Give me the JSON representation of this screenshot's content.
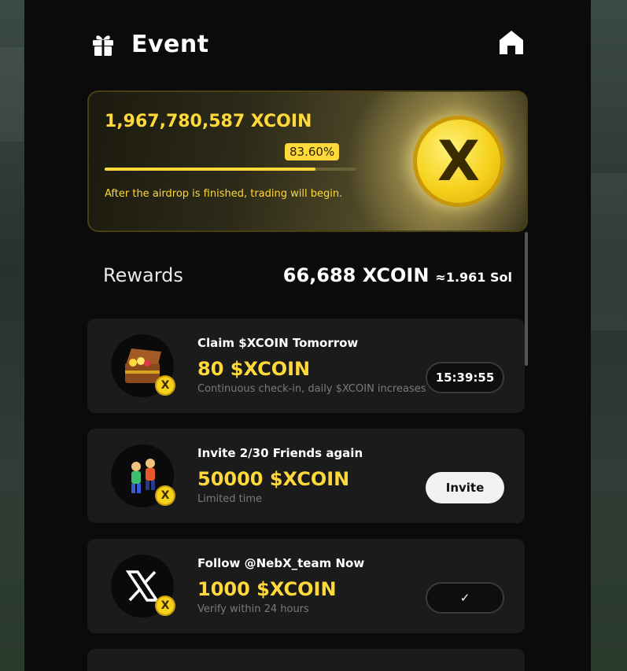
{
  "header": {
    "title": "Event",
    "gift_icon": "gift-icon",
    "home_icon": "home-icon"
  },
  "banner": {
    "total_amount": "1,967,780,587 XCOIN",
    "progress_label": "83.60%",
    "progress_value": 0.836,
    "note": "After the airdrop is finished, trading will begin.",
    "coin_symbol": "X"
  },
  "rewards": {
    "label": "Rewards",
    "amount": "66,688 XCOIN",
    "approx": "≈1.961 Sol"
  },
  "tasks": [
    {
      "title": "Claim $XCOIN Tomorrow",
      "reward": "80 $XCOIN",
      "sub": "Continuous check-in, daily $XCOIN increases",
      "button": "15:39:55",
      "icon": "treasure-chest-icon"
    },
    {
      "title": "Invite 2/30 Friends again",
      "reward": "50000 $XCOIN",
      "sub": "Limited time",
      "button": "Invite",
      "icon": "friends-icon"
    },
    {
      "title": "Follow @NebX_team Now",
      "reward": "1000 $XCOIN",
      "sub": "Verify within 24 hours",
      "button": "✓",
      "icon": "x-logo-icon"
    }
  ],
  "colors": {
    "accent": "#ffd93a",
    "panel": "#0b0b0b",
    "card": "#1b1b1b"
  }
}
